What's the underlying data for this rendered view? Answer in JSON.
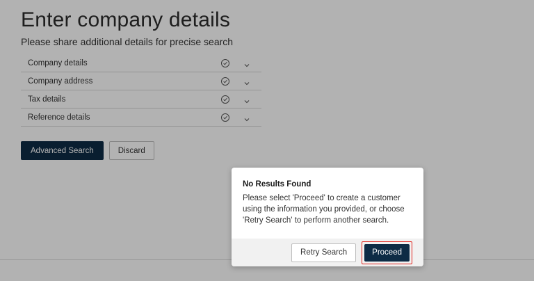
{
  "page": {
    "title": "Enter company details",
    "subtitle": "Please share additional details for precise search"
  },
  "accordion": {
    "items": [
      {
        "label": "Company details"
      },
      {
        "label": "Company address"
      },
      {
        "label": "Tax details"
      },
      {
        "label": "Reference details"
      }
    ]
  },
  "actions": {
    "advanced_search_label": "Advanced Search",
    "discard_label": "Discard"
  },
  "modal": {
    "title": "No Results Found",
    "message": "Please select 'Proceed' to create a customer using the information you provided, or choose 'Retry Search' to perform another search.",
    "retry_label": "Retry Search",
    "proceed_label": "Proceed"
  },
  "colors": {
    "primary": "#0d2b45",
    "highlight": "#e0241c",
    "overlay": "rgba(0,0,0,0.30)"
  },
  "icons": {
    "accordion_status": "check-circle-icon",
    "accordion_toggle": "chevron-down-icon"
  }
}
